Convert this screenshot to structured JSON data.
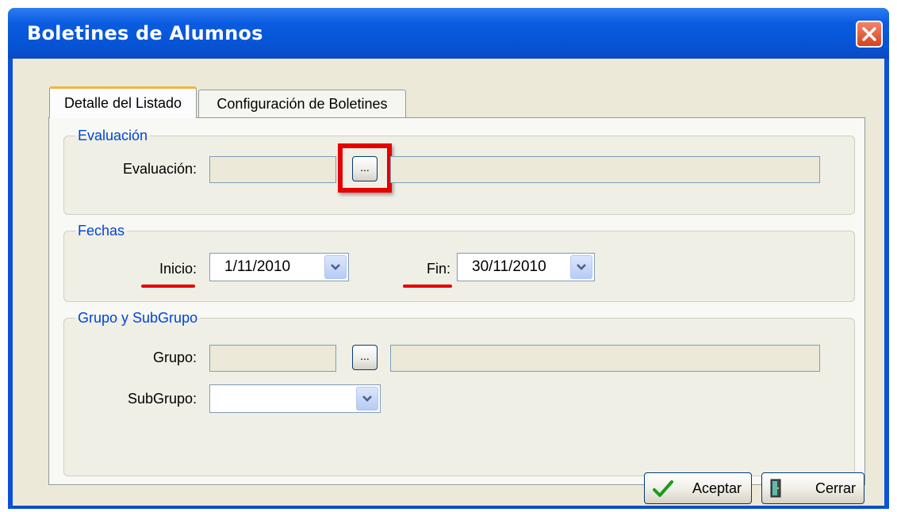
{
  "window": {
    "title": "Boletines de Alumnos"
  },
  "tabs": [
    {
      "label": "Detalle del Listado",
      "active": true
    },
    {
      "label": "Configuración de Boletines",
      "active": false
    }
  ],
  "evaluacion": {
    "legend": "Evaluación",
    "label": "Evaluación:",
    "code": "",
    "description": "",
    "browse_label": "..."
  },
  "fechas": {
    "legend": "Fechas",
    "inicio_label": "Inicio:",
    "inicio_value": "1/11/2010",
    "fin_label": "Fin:",
    "fin_value": "30/11/2010"
  },
  "grupo": {
    "legend": "Grupo y SubGrupo",
    "grupo_label": "Grupo:",
    "grupo_code": "",
    "grupo_description": "",
    "browse_label": "...",
    "subgrupo_label": "SubGrupo:",
    "subgrupo_value": ""
  },
  "buttons": {
    "accept": "Aceptar",
    "close": "Cerrar"
  },
  "colors": {
    "accent_red": "#e60000",
    "legend_blue": "#0046d5",
    "title_blue": "#0655d6"
  }
}
